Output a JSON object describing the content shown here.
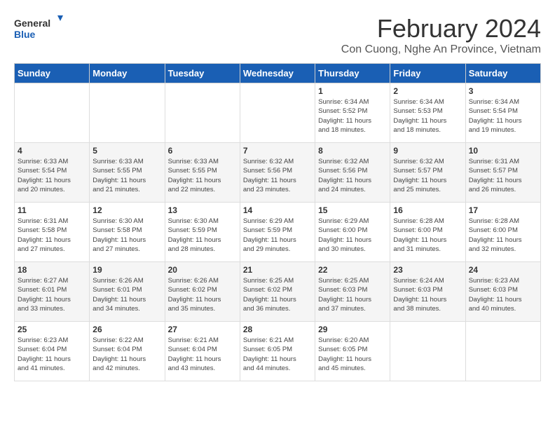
{
  "logo": {
    "text_general": "General",
    "text_blue": "Blue"
  },
  "header": {
    "title": "February 2024",
    "subtitle": "Con Cuong, Nghe An Province, Vietnam"
  },
  "weekdays": [
    "Sunday",
    "Monday",
    "Tuesday",
    "Wednesday",
    "Thursday",
    "Friday",
    "Saturday"
  ],
  "weeks": [
    [
      {
        "day": "",
        "info": ""
      },
      {
        "day": "",
        "info": ""
      },
      {
        "day": "",
        "info": ""
      },
      {
        "day": "",
        "info": ""
      },
      {
        "day": "1",
        "info": "Sunrise: 6:34 AM\nSunset: 5:52 PM\nDaylight: 11 hours\nand 18 minutes."
      },
      {
        "day": "2",
        "info": "Sunrise: 6:34 AM\nSunset: 5:53 PM\nDaylight: 11 hours\nand 18 minutes."
      },
      {
        "day": "3",
        "info": "Sunrise: 6:34 AM\nSunset: 5:54 PM\nDaylight: 11 hours\nand 19 minutes."
      }
    ],
    [
      {
        "day": "4",
        "info": "Sunrise: 6:33 AM\nSunset: 5:54 PM\nDaylight: 11 hours\nand 20 minutes."
      },
      {
        "day": "5",
        "info": "Sunrise: 6:33 AM\nSunset: 5:55 PM\nDaylight: 11 hours\nand 21 minutes."
      },
      {
        "day": "6",
        "info": "Sunrise: 6:33 AM\nSunset: 5:55 PM\nDaylight: 11 hours\nand 22 minutes."
      },
      {
        "day": "7",
        "info": "Sunrise: 6:32 AM\nSunset: 5:56 PM\nDaylight: 11 hours\nand 23 minutes."
      },
      {
        "day": "8",
        "info": "Sunrise: 6:32 AM\nSunset: 5:56 PM\nDaylight: 11 hours\nand 24 minutes."
      },
      {
        "day": "9",
        "info": "Sunrise: 6:32 AM\nSunset: 5:57 PM\nDaylight: 11 hours\nand 25 minutes."
      },
      {
        "day": "10",
        "info": "Sunrise: 6:31 AM\nSunset: 5:57 PM\nDaylight: 11 hours\nand 26 minutes."
      }
    ],
    [
      {
        "day": "11",
        "info": "Sunrise: 6:31 AM\nSunset: 5:58 PM\nDaylight: 11 hours\nand 27 minutes."
      },
      {
        "day": "12",
        "info": "Sunrise: 6:30 AM\nSunset: 5:58 PM\nDaylight: 11 hours\nand 27 minutes."
      },
      {
        "day": "13",
        "info": "Sunrise: 6:30 AM\nSunset: 5:59 PM\nDaylight: 11 hours\nand 28 minutes."
      },
      {
        "day": "14",
        "info": "Sunrise: 6:29 AM\nSunset: 5:59 PM\nDaylight: 11 hours\nand 29 minutes."
      },
      {
        "day": "15",
        "info": "Sunrise: 6:29 AM\nSunset: 6:00 PM\nDaylight: 11 hours\nand 30 minutes."
      },
      {
        "day": "16",
        "info": "Sunrise: 6:28 AM\nSunset: 6:00 PM\nDaylight: 11 hours\nand 31 minutes."
      },
      {
        "day": "17",
        "info": "Sunrise: 6:28 AM\nSunset: 6:00 PM\nDaylight: 11 hours\nand 32 minutes."
      }
    ],
    [
      {
        "day": "18",
        "info": "Sunrise: 6:27 AM\nSunset: 6:01 PM\nDaylight: 11 hours\nand 33 minutes."
      },
      {
        "day": "19",
        "info": "Sunrise: 6:26 AM\nSunset: 6:01 PM\nDaylight: 11 hours\nand 34 minutes."
      },
      {
        "day": "20",
        "info": "Sunrise: 6:26 AM\nSunset: 6:02 PM\nDaylight: 11 hours\nand 35 minutes."
      },
      {
        "day": "21",
        "info": "Sunrise: 6:25 AM\nSunset: 6:02 PM\nDaylight: 11 hours\nand 36 minutes."
      },
      {
        "day": "22",
        "info": "Sunrise: 6:25 AM\nSunset: 6:03 PM\nDaylight: 11 hours\nand 37 minutes."
      },
      {
        "day": "23",
        "info": "Sunrise: 6:24 AM\nSunset: 6:03 PM\nDaylight: 11 hours\nand 38 minutes."
      },
      {
        "day": "24",
        "info": "Sunrise: 6:23 AM\nSunset: 6:03 PM\nDaylight: 11 hours\nand 40 minutes."
      }
    ],
    [
      {
        "day": "25",
        "info": "Sunrise: 6:23 AM\nSunset: 6:04 PM\nDaylight: 11 hours\nand 41 minutes."
      },
      {
        "day": "26",
        "info": "Sunrise: 6:22 AM\nSunset: 6:04 PM\nDaylight: 11 hours\nand 42 minutes."
      },
      {
        "day": "27",
        "info": "Sunrise: 6:21 AM\nSunset: 6:04 PM\nDaylight: 11 hours\nand 43 minutes."
      },
      {
        "day": "28",
        "info": "Sunrise: 6:21 AM\nSunset: 6:05 PM\nDaylight: 11 hours\nand 44 minutes."
      },
      {
        "day": "29",
        "info": "Sunrise: 6:20 AM\nSunset: 6:05 PM\nDaylight: 11 hours\nand 45 minutes."
      },
      {
        "day": "",
        "info": ""
      },
      {
        "day": "",
        "info": ""
      }
    ]
  ]
}
